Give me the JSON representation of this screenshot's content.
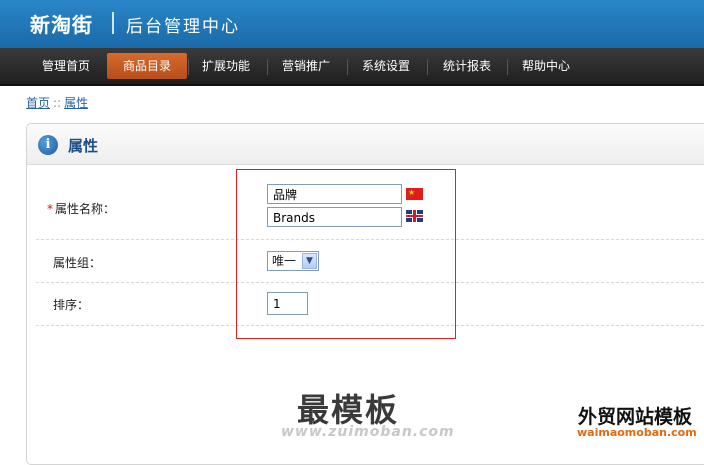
{
  "header": {
    "brand": "新淘街",
    "subtitle": "后台管理中心"
  },
  "nav": {
    "items": [
      {
        "label": "管理首页",
        "active": false
      },
      {
        "label": "商品目录",
        "active": true
      },
      {
        "label": "扩展功能",
        "active": false
      },
      {
        "label": "营销推广",
        "active": false
      },
      {
        "label": "系统设置",
        "active": false
      },
      {
        "label": "统计报表",
        "active": false
      },
      {
        "label": "帮助中心",
        "active": false
      }
    ]
  },
  "breadcrumb": {
    "home": "首页",
    "separator": "::",
    "current": "属性"
  },
  "panel": {
    "title": "属性",
    "fields": {
      "name": {
        "required_mark": "*",
        "label": "属性名称：",
        "value_zh": "品牌",
        "value_en": "Brands",
        "flag_zh": "cn-flag-icon",
        "flag_en": "uk-flag-icon"
      },
      "group": {
        "label": "属性组：",
        "selected": "唯一"
      },
      "order": {
        "label": "排序：",
        "value": "1"
      }
    }
  },
  "watermark": {
    "main": "最模板",
    "url": "www.zuimoban.com",
    "right_title": "外贸网站模板",
    "right_url": "waimaomoban.com"
  },
  "colors": {
    "header": "#1a6aa8",
    "nav_active": "#c85a22",
    "highlight_box": "#e02020",
    "link": "#2a63a5"
  }
}
